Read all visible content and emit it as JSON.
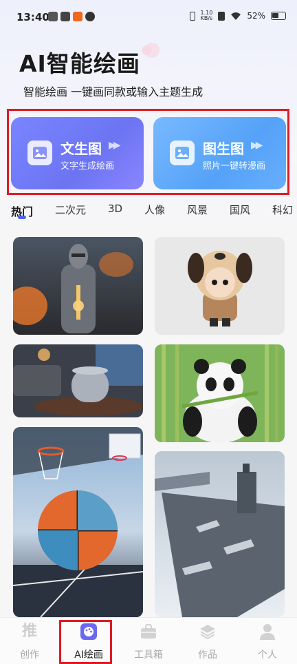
{
  "status_bar": {
    "time": "13:40",
    "net_speed_top": "1.10",
    "net_speed_unit": "KB/s",
    "battery": "52%"
  },
  "header": {
    "title": "AI智能绘画",
    "subtitle": "智能绘画 一键画同款或输入主题生成"
  },
  "feature_cards": [
    {
      "title": "文生图",
      "subtitle": "文字生成绘画",
      "icon": "image-text-icon"
    },
    {
      "title": "图生图",
      "subtitle": "照片一键转漫画",
      "icon": "image-icon"
    }
  ],
  "categories": [
    "热门",
    "二次元",
    "3D",
    "人像",
    "风景",
    "国风",
    "科幻"
  ],
  "active_category": "热门",
  "gallery": [
    {
      "subject": "knight",
      "column": "left"
    },
    {
      "subject": "chibi-dog-hat-boy",
      "column": "right"
    },
    {
      "subject": "smart-speaker-living-room",
      "column": "left"
    },
    {
      "subject": "panda-bamboo",
      "column": "right"
    },
    {
      "subject": "basketball-court",
      "column": "left"
    },
    {
      "subject": "aircraft-carrier",
      "column": "right"
    }
  ],
  "bottom_nav": {
    "items": [
      {
        "label": "创作",
        "icon": "tui-icon"
      },
      {
        "label": "AI绘画",
        "icon": "palette-icon"
      },
      {
        "label": "工具箱",
        "icon": "toolbox-icon"
      },
      {
        "label": "作品",
        "icon": "layers-icon"
      },
      {
        "label": "个人",
        "icon": "person-icon"
      }
    ],
    "active": "AI绘画"
  },
  "colors": {
    "accent": "#4f66f0",
    "card_left": "#7a85ff",
    "card_right": "#5aa6f8",
    "highlight_frame": "#e01b24"
  }
}
